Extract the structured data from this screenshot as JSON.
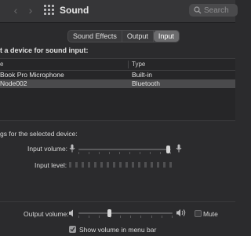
{
  "window": {
    "title": "Sound",
    "back_icon": "chevron-left-icon",
    "forward_icon": "chevron-right-icon",
    "grid_icon": "show-all-grid-icon"
  },
  "search": {
    "placeholder": "Search",
    "icon": "search-icon"
  },
  "tabs": [
    {
      "label": "Sound Effects",
      "active": false
    },
    {
      "label": "Output",
      "active": false
    },
    {
      "label": "Input",
      "active": true
    }
  ],
  "input_section": {
    "heading": "t a device for sound input:",
    "columns": [
      "e",
      "Type"
    ],
    "devices": [
      {
        "name": "Book Pro Microphone",
        "type": "Built-in",
        "selected": false
      },
      {
        "name": "Node002",
        "type": "Bluetooth",
        "selected": true
      }
    ]
  },
  "settings": {
    "label": "gs for the selected device:",
    "input_volume_label": "Input volume:",
    "input_volume": 0.95,
    "input_level_label": "Input level:",
    "input_level": 0
  },
  "output": {
    "label": "Output volume:",
    "volume": 0.4,
    "mute_label": "Mute",
    "mute_checked": false
  },
  "menu_bar": {
    "label": "Show volume in menu bar",
    "checked": true
  },
  "colors": {
    "background": "#2b2b2d",
    "selected_row": "#4a4a4c",
    "accent": "#d7d7d7"
  }
}
